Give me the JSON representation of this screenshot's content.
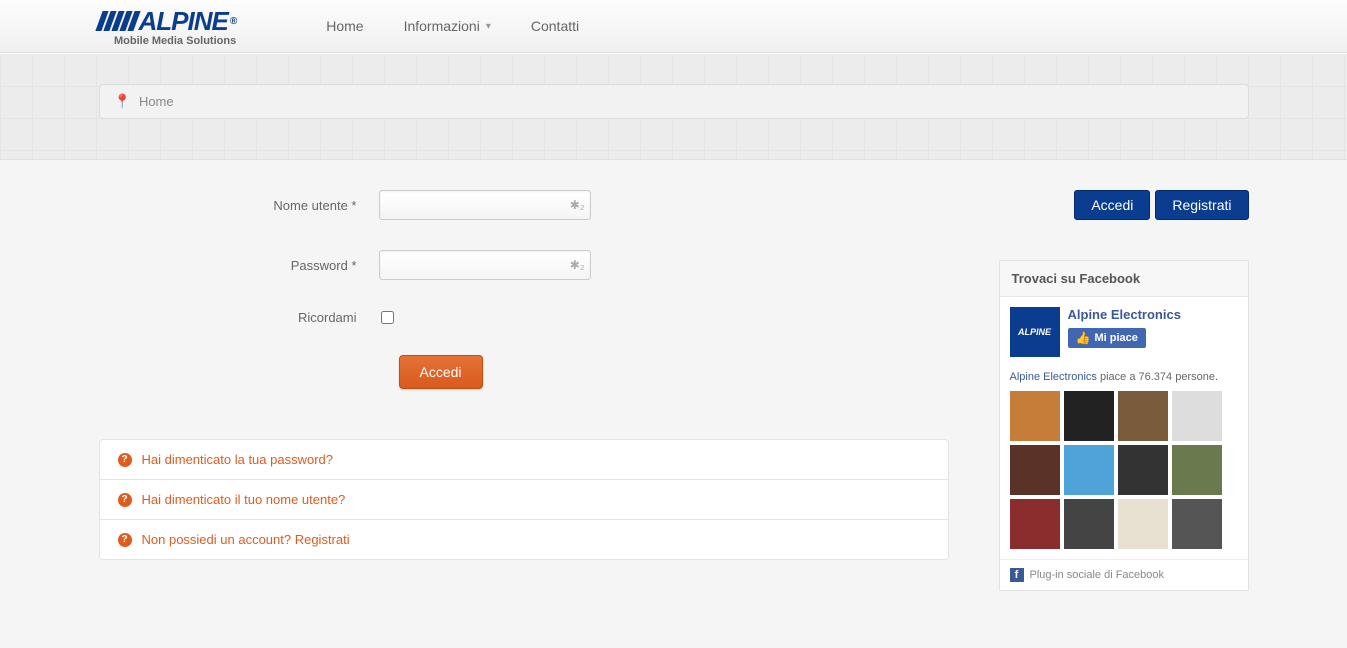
{
  "logo": {
    "text": "ALPINE",
    "tag": "®",
    "sub": "Mobile Media Solutions"
  },
  "nav": {
    "home": "Home",
    "info": "Informazioni",
    "contacts": "Contatti"
  },
  "breadcrumb": "Home",
  "form": {
    "username_label": "Nome utente *",
    "password_label": "Password *",
    "remember_label": "Ricordami",
    "submit": "Accedi"
  },
  "help": {
    "forgot_password": "Hai dimenticato la tua password?",
    "forgot_username": "Hai dimenticato il tuo nome utente?",
    "no_account": "Non possiedi un account? Registrati"
  },
  "side": {
    "login": "Accedi",
    "register": "Registrati",
    "fb_header": "Trovaci su Facebook",
    "fb_name": "Alpine Electronics",
    "fb_like": "Mi piace",
    "fb_stats_name": "Alpine Electronics",
    "fb_stats_text": " piace a 76.374 persone.",
    "fb_footer": "Plug-in sociale di Facebook"
  }
}
